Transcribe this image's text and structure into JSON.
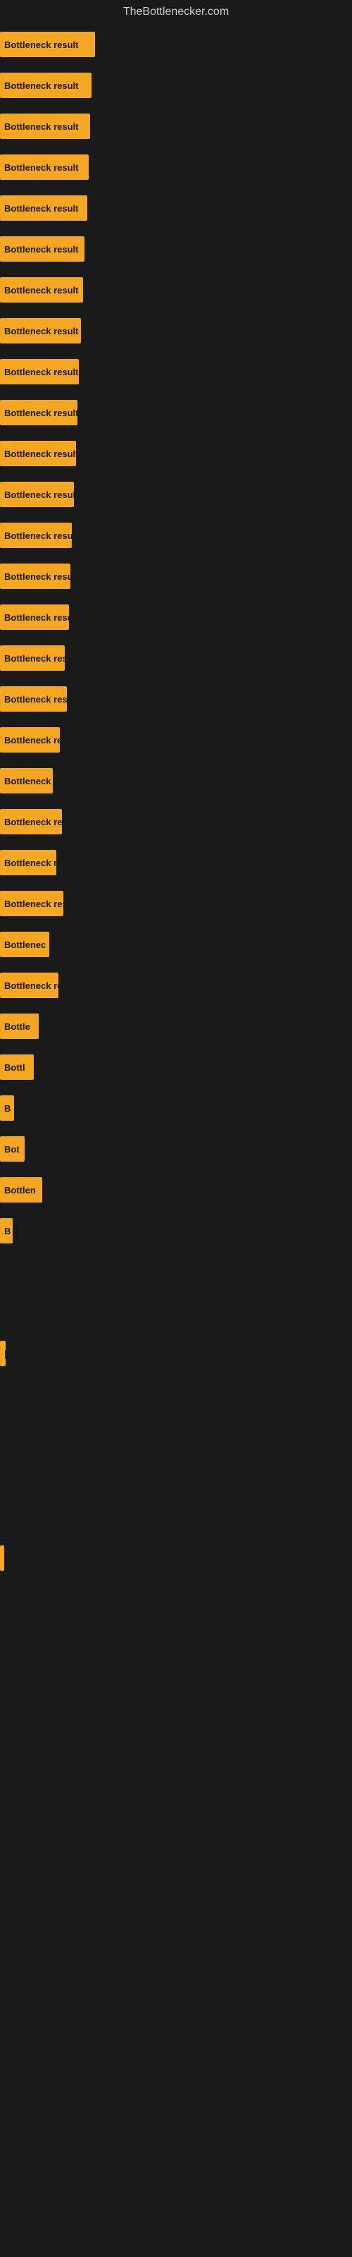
{
  "title": "TheBottlenecker.com",
  "bars": [
    {
      "label": "Bottleneck result",
      "width": 135
    },
    {
      "label": "Bottleneck result",
      "width": 130
    },
    {
      "label": "Bottleneck result",
      "width": 128
    },
    {
      "label": "Bottleneck result",
      "width": 126
    },
    {
      "label": "Bottleneck result",
      "width": 124
    },
    {
      "label": "Bottleneck result",
      "width": 120
    },
    {
      "label": "Bottleneck result",
      "width": 118
    },
    {
      "label": "Bottleneck result",
      "width": 115
    },
    {
      "label": "Bottleneck result",
      "width": 112
    },
    {
      "label": "Bottleneck result",
      "width": 110
    },
    {
      "label": "Bottleneck result",
      "width": 108
    },
    {
      "label": "Bottleneck result",
      "width": 105
    },
    {
      "label": "Bottleneck result",
      "width": 102
    },
    {
      "label": "Bottleneck result",
      "width": 100
    },
    {
      "label": "Bottleneck result",
      "width": 98
    },
    {
      "label": "Bottleneck resu",
      "width": 92
    },
    {
      "label": "Bottleneck result",
      "width": 95
    },
    {
      "label": "Bottleneck re",
      "width": 85
    },
    {
      "label": "Bottleneck",
      "width": 75
    },
    {
      "label": "Bottleneck res",
      "width": 88
    },
    {
      "label": "Bottleneck r",
      "width": 80
    },
    {
      "label": "Bottleneck resu",
      "width": 90
    },
    {
      "label": "Bottlenec",
      "width": 70
    },
    {
      "label": "Bottleneck re",
      "width": 83
    },
    {
      "label": "Bottle",
      "width": 55
    },
    {
      "label": "Bottl",
      "width": 48
    },
    {
      "label": "B",
      "width": 20
    },
    {
      "label": "Bot",
      "width": 35
    },
    {
      "label": "Bottlen",
      "width": 60
    },
    {
      "label": "B",
      "width": 18
    },
    {
      "label": "",
      "width": 0
    },
    {
      "label": "",
      "width": 0
    },
    {
      "label": "|",
      "width": 8
    },
    {
      "label": "",
      "width": 0
    },
    {
      "label": "",
      "width": 0
    },
    {
      "label": "",
      "width": 0
    },
    {
      "label": "",
      "width": 0
    },
    {
      "label": "",
      "width": 5
    }
  ]
}
